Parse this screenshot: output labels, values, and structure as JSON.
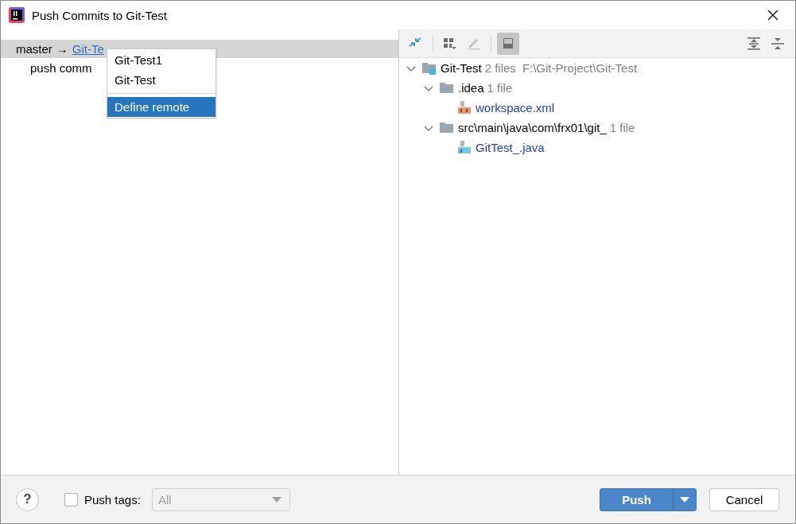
{
  "window": {
    "title": "Push Commits to Git-Test"
  },
  "commits": {
    "branch_row": {
      "local": "master",
      "arrow": "→",
      "remote_link": "Git-Te",
      "selected": true
    },
    "items": [
      {
        "label": "push comm"
      }
    ]
  },
  "remote_menu": {
    "items": [
      {
        "label": "Git-Test1",
        "selected": false,
        "kind": "remote"
      },
      {
        "label": "Git-Test",
        "selected": false,
        "kind": "remote"
      },
      {
        "label": "Define remote",
        "selected": true,
        "kind": "action"
      }
    ]
  },
  "changes_toolbar": {
    "buttons": [
      {
        "kind": "merge",
        "selected": false,
        "disabled": false
      },
      {
        "kind": "group",
        "selected": false,
        "disabled": false
      },
      {
        "kind": "edit",
        "selected": false,
        "disabled": true
      },
      {
        "kind": "preview",
        "selected": true,
        "disabled": false
      },
      {
        "kind": "expand-all",
        "selected": false,
        "disabled": false
      },
      {
        "kind": "collapse-all",
        "selected": false,
        "disabled": false
      }
    ]
  },
  "tree": [
    {
      "name": "Git-Test",
      "count": "2 files",
      "path": "F:\\Git-Project\\Git-Test",
      "kind": "module",
      "expanded": true,
      "children": [
        {
          "name": ".idea",
          "count": "1 file",
          "kind": "folder",
          "expanded": true,
          "children": [
            {
              "name": "workspace.xml",
              "kind": "xml"
            }
          ]
        },
        {
          "name": "src\\main\\java\\com\\frx01\\git_",
          "count": "1 file",
          "kind": "folder",
          "expanded": true,
          "children": [
            {
              "name": "GitTest_.java",
              "kind": "java"
            }
          ]
        }
      ]
    }
  ],
  "footer": {
    "help": "?",
    "push_tags": {
      "label": "Push tags:",
      "checked": false
    },
    "tags_dropdown": {
      "value": "All",
      "disabled": true
    },
    "push_button": {
      "label": "Push"
    },
    "cancel_button": {
      "label": "Cancel"
    }
  }
}
